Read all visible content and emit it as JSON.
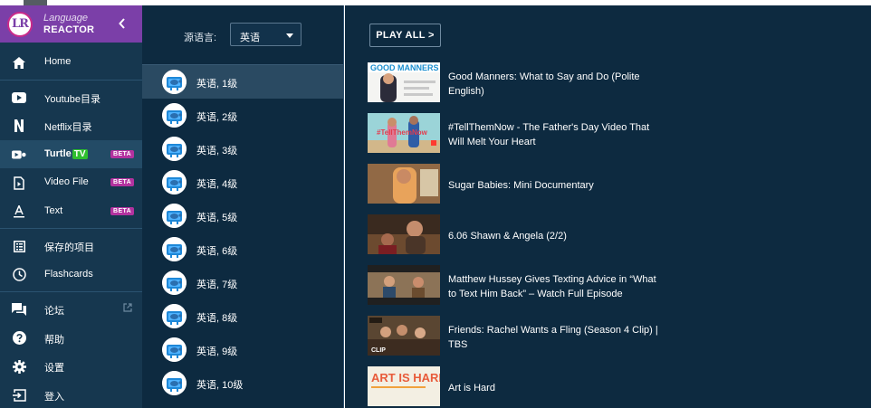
{
  "brand": {
    "line1": "Language",
    "line2": "REACTOR",
    "logo": "LR",
    "color": "#7b3fa8"
  },
  "sidebar": {
    "items": [
      {
        "label": "Home",
        "icon": "home-icon"
      },
      {
        "label": "Youtube目录",
        "icon": "youtube-icon"
      },
      {
        "label": "Netflix目录",
        "icon": "netflix-icon"
      },
      {
        "label": "Turtle",
        "badge": "TV",
        "beta": "BETA",
        "icon": "turtle-tv-icon"
      },
      {
        "label": "Video File",
        "beta": "BETA",
        "icon": "video-file-icon"
      },
      {
        "label": "Text",
        "beta": "BETA",
        "icon": "text-icon"
      },
      {
        "label": "保存的项目",
        "icon": "saved-items-icon"
      },
      {
        "label": "Flashcards",
        "icon": "clock-icon"
      },
      {
        "label": "论坛",
        "icon": "forum-icon"
      },
      {
        "label": "帮助",
        "icon": "help-icon"
      },
      {
        "label": "设置",
        "icon": "settings-icon"
      },
      {
        "label": "登入",
        "icon": "login-icon"
      }
    ]
  },
  "source": {
    "label": "源语言:",
    "value": "英语"
  },
  "levels": [
    "英语, 1级",
    "英语, 2级",
    "英语, 3级",
    "英语, 4级",
    "英语, 5级",
    "英语, 6级",
    "英语, 7级",
    "英语, 8级",
    "英语, 9级",
    "英语, 10级"
  ],
  "play_all": "PLAY ALL >",
  "videos": [
    {
      "title": "Good Manners: What to Say and Do (Polite English)",
      "thumb_text": "GOOD MANNERS"
    },
    {
      "title": "#TellThemNow - The Father's Day Video That Will Melt Your Heart",
      "thumb_text": "#TellThemNow"
    },
    {
      "title": "Sugar Babies: Mini Documentary"
    },
    {
      "title": "6.06 Shawn & Angela (2/2)"
    },
    {
      "title": "Matthew Hussey Gives Texting Advice in “What to Text Him Back” – Watch Full Episode"
    },
    {
      "title": "Friends: Rachel Wants a Fling (Season 4 Clip) | TBS",
      "thumb_text": "CLIP"
    },
    {
      "title": "Art is Hard",
      "thumb_text": "ART IS HARD"
    }
  ]
}
